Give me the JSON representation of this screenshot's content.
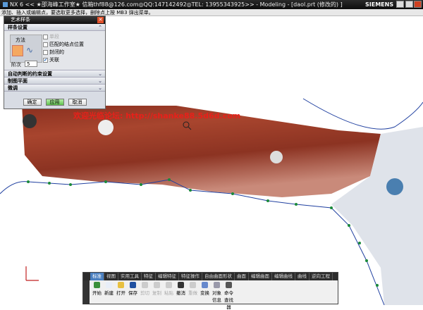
{
  "window": {
    "title": "NX 6 << ★邵海峰工作室★  信箱thf88@126.com◎QQ:147142492◎TEL: 13955343925>> - Modeling - [daol.prt  (修改的) ]",
    "brand": "SIEMENS"
  },
  "cue_line": "添加、插入或编辑点，要选取更多选择，删除点上按 MB3 弹出菜单。",
  "dialog": {
    "title": "艺术样条",
    "section_spline": "样条设置",
    "method_label": "方法",
    "options": [
      {
        "label": "单段",
        "checked": false,
        "disabled": true
      },
      {
        "label": "匹配的结点位置",
        "checked": false
      },
      {
        "label": "封闭的",
        "checked": false
      },
      {
        "label": "关联",
        "checked": true
      }
    ],
    "degree_label": "阶次",
    "degree_value": "5",
    "sections": [
      "自动判断的约束设置",
      "制图平面",
      "微调"
    ],
    "buttons": {
      "ok": "确定",
      "apply": "应用",
      "cancel": "取消"
    }
  },
  "watermark": "欢迎光临论坛: http://shanke88.5d6d.com",
  "ribbon": {
    "tabs": [
      "标准",
      "视图",
      "实用工具",
      "特征",
      "编辑特征",
      "特征操作",
      "自由曲面形状",
      "曲面",
      "编辑曲面",
      "编辑曲线",
      "曲线",
      "逆向工程"
    ],
    "tools": [
      {
        "label": "开始",
        "color": "#3a8f3a"
      },
      {
        "label": "新建",
        "color": "#e8eef8"
      },
      {
        "label": "打开",
        "color": "#e8c040"
      },
      {
        "label": "保存",
        "color": "#2050a0"
      },
      {
        "label": "剪切",
        "color": "#ccc",
        "disabled": true
      },
      {
        "label": "复制",
        "color": "#ccc",
        "disabled": true
      },
      {
        "label": "粘贴",
        "color": "#ccc",
        "disabled": true
      },
      {
        "label": "撤消",
        "color": "#333"
      },
      {
        "label": "重做",
        "color": "#ccc",
        "disabled": true
      },
      {
        "label": "变换",
        "color": "#6688cc"
      },
      {
        "label": "对象信息",
        "color": "#99a"
      },
      {
        "label": "命令查找器",
        "color": "#555"
      }
    ]
  }
}
